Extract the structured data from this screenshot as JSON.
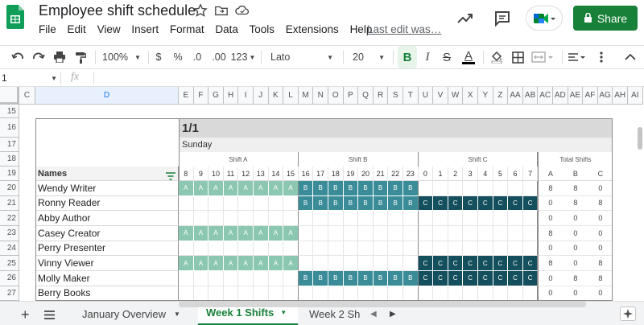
{
  "header": {
    "title": "Employee shift schedule",
    "menu": [
      "File",
      "Edit",
      "View",
      "Insert",
      "Format",
      "Data",
      "Tools",
      "Extensions",
      "Help"
    ],
    "last_edit": "Last edit was…",
    "share_label": "Share",
    "icons": [
      "sheets-logo",
      "star-icon",
      "move-folder-icon",
      "cloud-status-icon",
      "activity-trend-icon",
      "comments-icon",
      "meet-icon",
      "lock-icon"
    ]
  },
  "toolbar": {
    "zoom": "100%",
    "currency": "$",
    "percent": "%",
    "dec_decrease": ".0",
    "dec_increase": ".00",
    "more_formats": "123",
    "font": "Lato",
    "font_size": "20",
    "bold": "B",
    "italic": "I",
    "strike": "S",
    "text_color": "A"
  },
  "formula_bar": {
    "cell_ref": "1",
    "fx": "fx",
    "content": ""
  },
  "grid": {
    "col_letters": [
      "C",
      "D",
      "E",
      "F",
      "G",
      "H",
      "I",
      "J",
      "K",
      "L",
      "M",
      "N",
      "O",
      "P",
      "Q",
      "R",
      "S",
      "T",
      "U",
      "V",
      "W",
      "X",
      "Y",
      "Z",
      "AA",
      "AB",
      "AC",
      "AD",
      "AE",
      "AF",
      "AG",
      "AH",
      "AI"
    ],
    "selected_col": "D",
    "row_numbers": [
      "15",
      "16",
      "17",
      "18",
      "19",
      "20",
      "21",
      "22",
      "23",
      "24",
      "25",
      "26",
      "27"
    ],
    "date": "1/1",
    "weekday": "Sunday",
    "shift_groups": [
      "Shift A",
      "Shift B",
      "Shift C",
      "Total Shifts"
    ],
    "names_header": "Names",
    "hours": [
      "8",
      "9",
      "10",
      "11",
      "12",
      "13",
      "14",
      "15",
      "16",
      "17",
      "18",
      "19",
      "20",
      "21",
      "22",
      "23",
      "0",
      "1",
      "2",
      "3",
      "4",
      "5",
      "6",
      "7"
    ],
    "total_heads": [
      "A",
      "B",
      "C"
    ],
    "employees": [
      {
        "name": "Wendy Writer",
        "a": true,
        "b": true,
        "c": false,
        "totals": [
          "8",
          "8",
          "0"
        ]
      },
      {
        "name": "Ronny Reader",
        "a": false,
        "b": true,
        "c": true,
        "totals": [
          "0",
          "8",
          "8"
        ]
      },
      {
        "name": "Abby Author",
        "a": false,
        "b": false,
        "c": false,
        "totals": [
          "0",
          "0",
          "0"
        ]
      },
      {
        "name": "Casey Creator",
        "a": true,
        "b": false,
        "c": false,
        "totals": [
          "8",
          "0",
          "0"
        ]
      },
      {
        "name": "Perry Presenter",
        "a": false,
        "b": false,
        "c": false,
        "totals": [
          "0",
          "0",
          "0"
        ]
      },
      {
        "name": "Vinny Viewer",
        "a": true,
        "b": false,
        "c": true,
        "totals": [
          "8",
          "0",
          "8"
        ]
      },
      {
        "name": "Molly Maker",
        "a": false,
        "b": true,
        "c": true,
        "totals": [
          "0",
          "8",
          "8"
        ]
      },
      {
        "name": "Berry Books",
        "a": false,
        "b": false,
        "c": false,
        "totals": [
          "0",
          "0",
          "0"
        ]
      }
    ],
    "letters": {
      "a": "A",
      "b": "B",
      "c": "C"
    }
  },
  "tabs": {
    "items": [
      "January Overview",
      "Week 1 Shifts",
      "Week 2 Sh"
    ],
    "active": "Week 1 Shifts"
  },
  "colors": {
    "brand_green": "#188038",
    "shift_a": "#8cc7b1",
    "shift_b": "#3a8c98",
    "shift_c": "#134f5c"
  }
}
